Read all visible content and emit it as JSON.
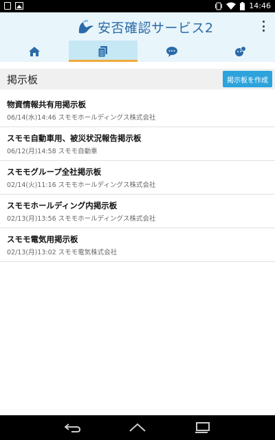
{
  "status_bar": {
    "time": "14:46"
  },
  "app": {
    "title": "安否確認サービス2"
  },
  "tabs": [
    {
      "name": "home",
      "icon": "home-icon"
    },
    {
      "name": "board",
      "icon": "board-icon",
      "active": true
    },
    {
      "name": "message",
      "icon": "chat-icon"
    },
    {
      "name": "profile",
      "icon": "profile-icon"
    }
  ],
  "section": {
    "title": "掲示板",
    "create_button_label": "掲示板を作成"
  },
  "boards": [
    {
      "title": "物資情報共有用掲示板",
      "meta": "06/14(水)14:46 スモモホールディングス株式会社"
    },
    {
      "title": "スモモ自動車用、被災状況報告掲示板",
      "meta": "06/12(月)14:58 スモモ自動車"
    },
    {
      "title": "スモモグループ全社掲示板",
      "meta": "02/14(火)11:16 スモモホールディングス株式会社"
    },
    {
      "title": "スモモホールディング内掲示板",
      "meta": "02/13(月)13:56 スモモホールディングス株式会社"
    },
    {
      "title": "スモモ電気用掲示板",
      "meta": "02/13(月)13:02 スモモ電気株式会社"
    }
  ],
  "colors": {
    "header_bg": "#e8f5fb",
    "active_tab_bg": "#c6e8f5",
    "active_tab_indicator": "#f0a93a",
    "accent": "#2da3dc",
    "icon": "#2b6aa8"
  }
}
